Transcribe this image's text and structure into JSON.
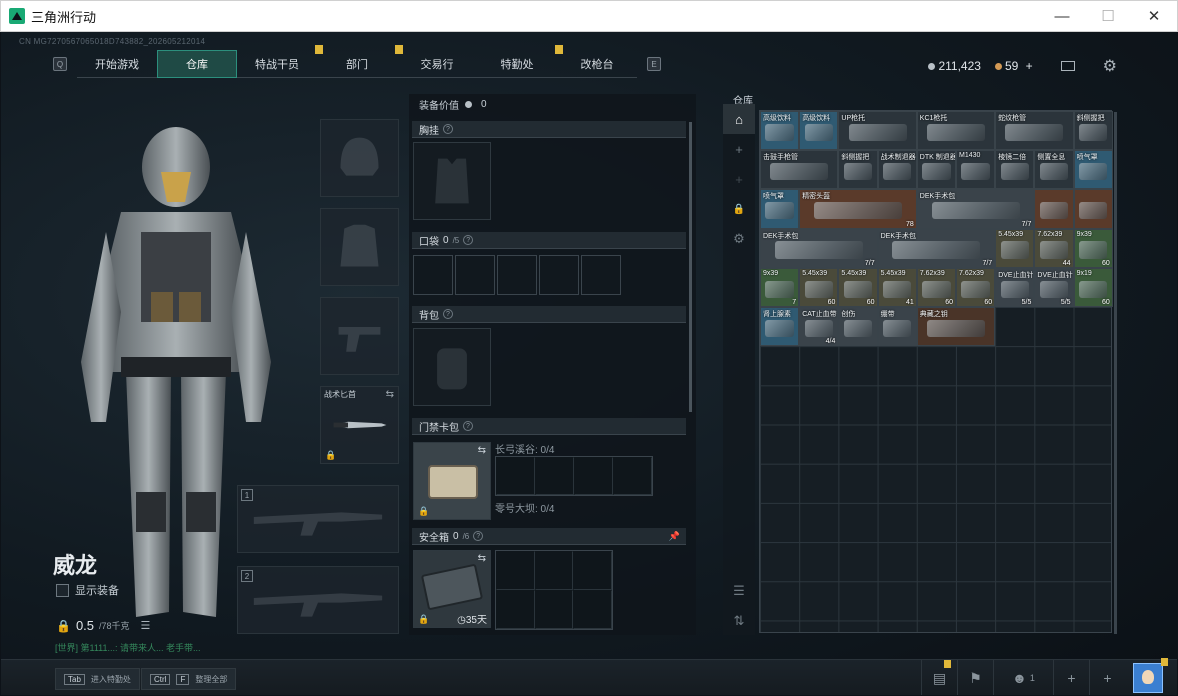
{
  "window": {
    "title": "三角洲行动"
  },
  "build_id": "CN MG7270567065018D743882_202605212014",
  "nav": {
    "left_key": "Q",
    "right_key": "E",
    "tabs": [
      {
        "label": "开始游戏",
        "active": false,
        "badge": false
      },
      {
        "label": "仓库",
        "active": true,
        "badge": false
      },
      {
        "label": "特战干员",
        "active": false,
        "badge": true
      },
      {
        "label": "部门",
        "active": false,
        "badge": true
      },
      {
        "label": "交易行",
        "active": false,
        "badge": false
      },
      {
        "label": "特勤处",
        "active": false,
        "badge": true
      },
      {
        "label": "改枪台",
        "active": false,
        "badge": false
      }
    ]
  },
  "currency": {
    "silver": "211,423",
    "gold": "59",
    "plus": "+"
  },
  "character": {
    "name": "威龙",
    "show_gear_label": "显示装备",
    "weight_value": "0.5",
    "weight_max": "/78千克"
  },
  "chat": {
    "text": "[世界] 第1111...: 请带来人... 老手带..."
  },
  "gear_slots": {
    "melee_label": "战术匕首",
    "slot1": "1",
    "slot2": "2"
  },
  "middle": {
    "value_label": "装备价值",
    "value": "0",
    "chest_label": "胸挂",
    "pocket_label": "口袋",
    "pocket_count": "0",
    "pocket_max": "/5",
    "backpack_label": "背包",
    "keycard_label": "门禁卡包",
    "keycard_sub1": "长弓溪谷: 0/4",
    "keycard_sub2": "零号大坝: 0/4",
    "safe_label": "安全箱",
    "safe_count": "0",
    "safe_max": "/6",
    "safe_days": "35天"
  },
  "warehouse": {
    "title": "仓库",
    "items": [
      {
        "name": "高级饮料",
        "c": 0,
        "r": 0,
        "w": 1,
        "h": 1,
        "count": "",
        "color": "#2f5a72"
      },
      {
        "name": "高级饮料",
        "c": 1,
        "r": 0,
        "w": 1,
        "h": 1,
        "count": "",
        "color": "#2f5a72"
      },
      {
        "name": "UP枪托",
        "c": 2,
        "r": 0,
        "w": 2,
        "h": 1,
        "count": "",
        "color": "#2b343b"
      },
      {
        "name": "KC1枪托",
        "c": 4,
        "r": 0,
        "w": 2,
        "h": 1,
        "count": "",
        "color": "#2b343b"
      },
      {
        "name": "蛇纹枪管",
        "c": 6,
        "r": 0,
        "w": 2,
        "h": 1,
        "count": "",
        "color": "#2b343b"
      },
      {
        "name": "斜侧握把",
        "c": 8,
        "r": 0,
        "w": 1,
        "h": 1,
        "count": "",
        "color": "#2b343b"
      },
      {
        "name": "击鼓手枪管",
        "c": 0,
        "r": 1,
        "w": 2,
        "h": 1,
        "count": "",
        "color": "#2b343b"
      },
      {
        "name": "斜侧握把",
        "c": 2,
        "r": 1,
        "w": 1,
        "h": 1,
        "count": "",
        "color": "#2b343b"
      },
      {
        "name": "战术制退器",
        "c": 3,
        "r": 1,
        "w": 1,
        "h": 1,
        "count": "",
        "color": "#2b343b"
      },
      {
        "name": "DTK 制退器",
        "c": 4,
        "r": 1,
        "w": 1,
        "h": 1,
        "count": "",
        "color": "#2b343b"
      },
      {
        "name": "M1430",
        "c": 5,
        "r": 1,
        "w": 1,
        "h": 1,
        "count": "",
        "color": "#2b343b"
      },
      {
        "name": "棱镜二倍",
        "c": 6,
        "r": 1,
        "w": 1,
        "h": 1,
        "count": "",
        "color": "#2b343b"
      },
      {
        "name": "侧置全息",
        "c": 7,
        "r": 1,
        "w": 1,
        "h": 1,
        "count": "",
        "color": "#2b343b"
      },
      {
        "name": "喷气罩",
        "c": 8,
        "r": 1,
        "w": 1,
        "h": 1,
        "count": "",
        "color": "#2f5a72"
      },
      {
        "name": "喷气罩",
        "c": 0,
        "r": 2,
        "w": 1,
        "h": 1,
        "count": "",
        "color": "#2f5a72"
      },
      {
        "name": "精密头盔",
        "c": 1,
        "r": 2,
        "w": 3,
        "h": 1,
        "count": "78",
        "color": "#5a3a2a"
      },
      {
        "name": "DEK手术包",
        "c": 4,
        "r": 2,
        "w": 3,
        "h": 1,
        "count": "7/7",
        "color": "#3a434a"
      },
      {
        "name": "",
        "c": 7,
        "r": 2,
        "w": 1,
        "h": 1,
        "count": "",
        "color": "#5a3a2a"
      },
      {
        "name": "",
        "c": 8,
        "r": 2,
        "w": 1,
        "h": 1,
        "count": "",
        "color": "#5a3a2a"
      },
      {
        "name": "DEK手术包",
        "c": 0,
        "r": 3,
        "w": 3,
        "h": 1,
        "count": "7/7",
        "color": "#3a434a"
      },
      {
        "name": "DEK手术包",
        "c": 3,
        "r": 3,
        "w": 3,
        "h": 1,
        "count": "7/7",
        "color": "#3a434a"
      },
      {
        "name": "5.45x39",
        "c": 6,
        "r": 3,
        "w": 1,
        "h": 1,
        "count": "",
        "color": "#4a4a3a"
      },
      {
        "name": "7.62x39",
        "c": 7,
        "r": 3,
        "w": 1,
        "h": 1,
        "count": "44",
        "color": "#4a4a3a"
      },
      {
        "name": "9x39",
        "c": 8,
        "r": 3,
        "w": 1,
        "h": 1,
        "count": "60",
        "color": "#3a5a3a"
      },
      {
        "name": "9x39",
        "c": 0,
        "r": 4,
        "w": 1,
        "h": 1,
        "count": "7",
        "color": "#3a5a3a"
      },
      {
        "name": "5.45x39",
        "c": 1,
        "r": 4,
        "w": 1,
        "h": 1,
        "count": "60",
        "color": "#4a4a3a"
      },
      {
        "name": "5.45x39",
        "c": 2,
        "r": 4,
        "w": 1,
        "h": 1,
        "count": "60",
        "color": "#4a4a3a"
      },
      {
        "name": "5.45x39",
        "c": 3,
        "r": 4,
        "w": 1,
        "h": 1,
        "count": "41",
        "color": "#4a4a3a"
      },
      {
        "name": "7.62x39",
        "c": 4,
        "r": 4,
        "w": 1,
        "h": 1,
        "count": "60",
        "color": "#4a4a3a"
      },
      {
        "name": "7.62x39",
        "c": 5,
        "r": 4,
        "w": 1,
        "h": 1,
        "count": "60",
        "color": "#4a4a3a"
      },
      {
        "name": "DVE止血针",
        "c": 6,
        "r": 4,
        "w": 1,
        "h": 1,
        "count": "5/5",
        "color": "#3a434a"
      },
      {
        "name": "DVE止血针",
        "c": 7,
        "r": 4,
        "w": 1,
        "h": 1,
        "count": "5/5",
        "color": "#3a434a"
      },
      {
        "name": "9x19",
        "c": 8,
        "r": 4,
        "w": 1,
        "h": 1,
        "count": "60",
        "color": "#3a5a3a"
      },
      {
        "name": "肾上腺素",
        "c": 0,
        "r": 5,
        "w": 1,
        "h": 1,
        "count": "",
        "color": "#2f5a72"
      },
      {
        "name": "CAT止血带",
        "c": 1,
        "r": 5,
        "w": 1,
        "h": 1,
        "count": "4/4",
        "color": "#3a434a"
      },
      {
        "name": "创伤",
        "c": 2,
        "r": 5,
        "w": 1,
        "h": 1,
        "count": "",
        "color": "#3a434a"
      },
      {
        "name": "绷带",
        "c": 3,
        "r": 5,
        "w": 1,
        "h": 1,
        "count": "",
        "color": "#3a434a"
      },
      {
        "name": "典藏之钥",
        "c": 4,
        "r": 5,
        "w": 2,
        "h": 1,
        "count": "",
        "color": "#4a3428"
      }
    ]
  },
  "bottom": {
    "tab_key": "Tab",
    "tab_label": "进入特勤处",
    "ctrl_key": "Ctrl",
    "f_key": "F",
    "ctrl_label": "整理全部",
    "friends_count": "1"
  }
}
